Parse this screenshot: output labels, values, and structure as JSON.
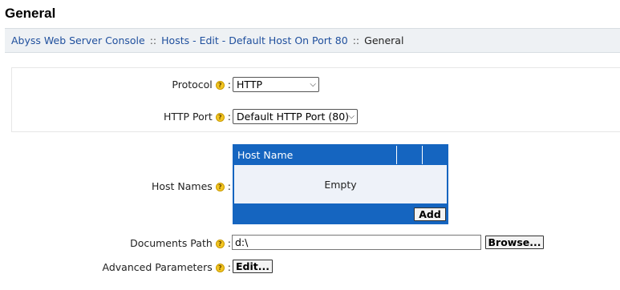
{
  "page": {
    "title": "General"
  },
  "breadcrumb": {
    "items": [
      "Abyss Web Server Console",
      "Hosts - Edit - Default Host On Port 80"
    ],
    "separator": "::",
    "current": "General"
  },
  "form": {
    "protocol": {
      "label": "Protocol",
      "value": "HTTP"
    },
    "http_port": {
      "label": "HTTP Port",
      "value": "Default HTTP Port (80)"
    },
    "host_names": {
      "label": "Host Names",
      "column_header": "Host Name",
      "empty_text": "Empty",
      "add_label": "Add"
    },
    "documents_path": {
      "label": "Documents Path",
      "value": "d:\\",
      "browse_label": "Browse..."
    },
    "advanced_parameters": {
      "label": "Advanced Parameters",
      "edit_label": "Edit..."
    },
    "colon": ":",
    "help_glyph": "?"
  },
  "colors": {
    "accent": "#1565c0",
    "link": "#1f4f9d",
    "help_icon": "#f3c623",
    "breadcrumb_bg": "#eef1f4"
  }
}
